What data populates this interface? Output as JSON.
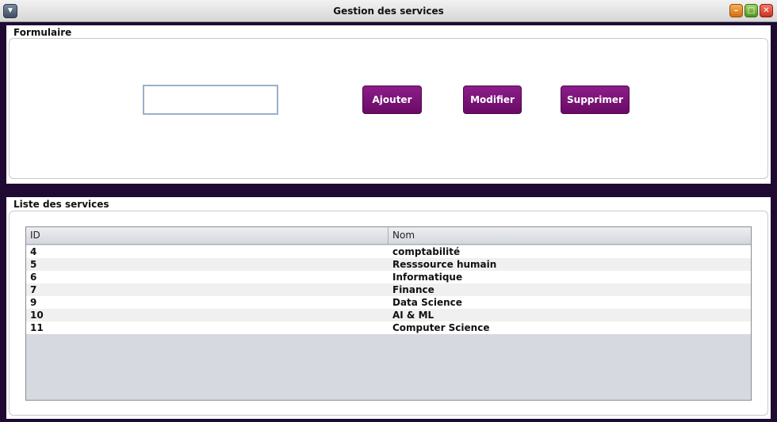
{
  "window": {
    "title": "Gestion des services",
    "system_menu_icon": "chevron-down-icon",
    "controls": {
      "minimize_icon": "minimize-icon",
      "maximize_icon": "maximize-icon",
      "close_icon": "close-icon",
      "minimize_glyph": "–",
      "maximize_glyph": "□",
      "close_glyph": "✕",
      "menu_glyph": "▼"
    }
  },
  "form": {
    "title": "Formulaire",
    "input_value": "",
    "buttons": {
      "add": "Ajouter",
      "edit": "Modifier",
      "delete": "Supprimer"
    }
  },
  "list": {
    "title": "Liste des services",
    "columns": [
      "ID",
      "Nom"
    ],
    "rows": [
      {
        "id": "4",
        "nom": "comptabilité"
      },
      {
        "id": "5",
        "nom": "Resssource humain"
      },
      {
        "id": "6",
        "nom": "Informatique"
      },
      {
        "id": "7",
        "nom": "Finance"
      },
      {
        "id": "9",
        "nom": "Data Science"
      },
      {
        "id": "10",
        "nom": "AI & ML"
      },
      {
        "id": "11",
        "nom": "Computer Science"
      }
    ]
  },
  "colors": {
    "frame": "#1e0a33",
    "button": "#7a1477",
    "table_empty": "#d6d9df"
  }
}
